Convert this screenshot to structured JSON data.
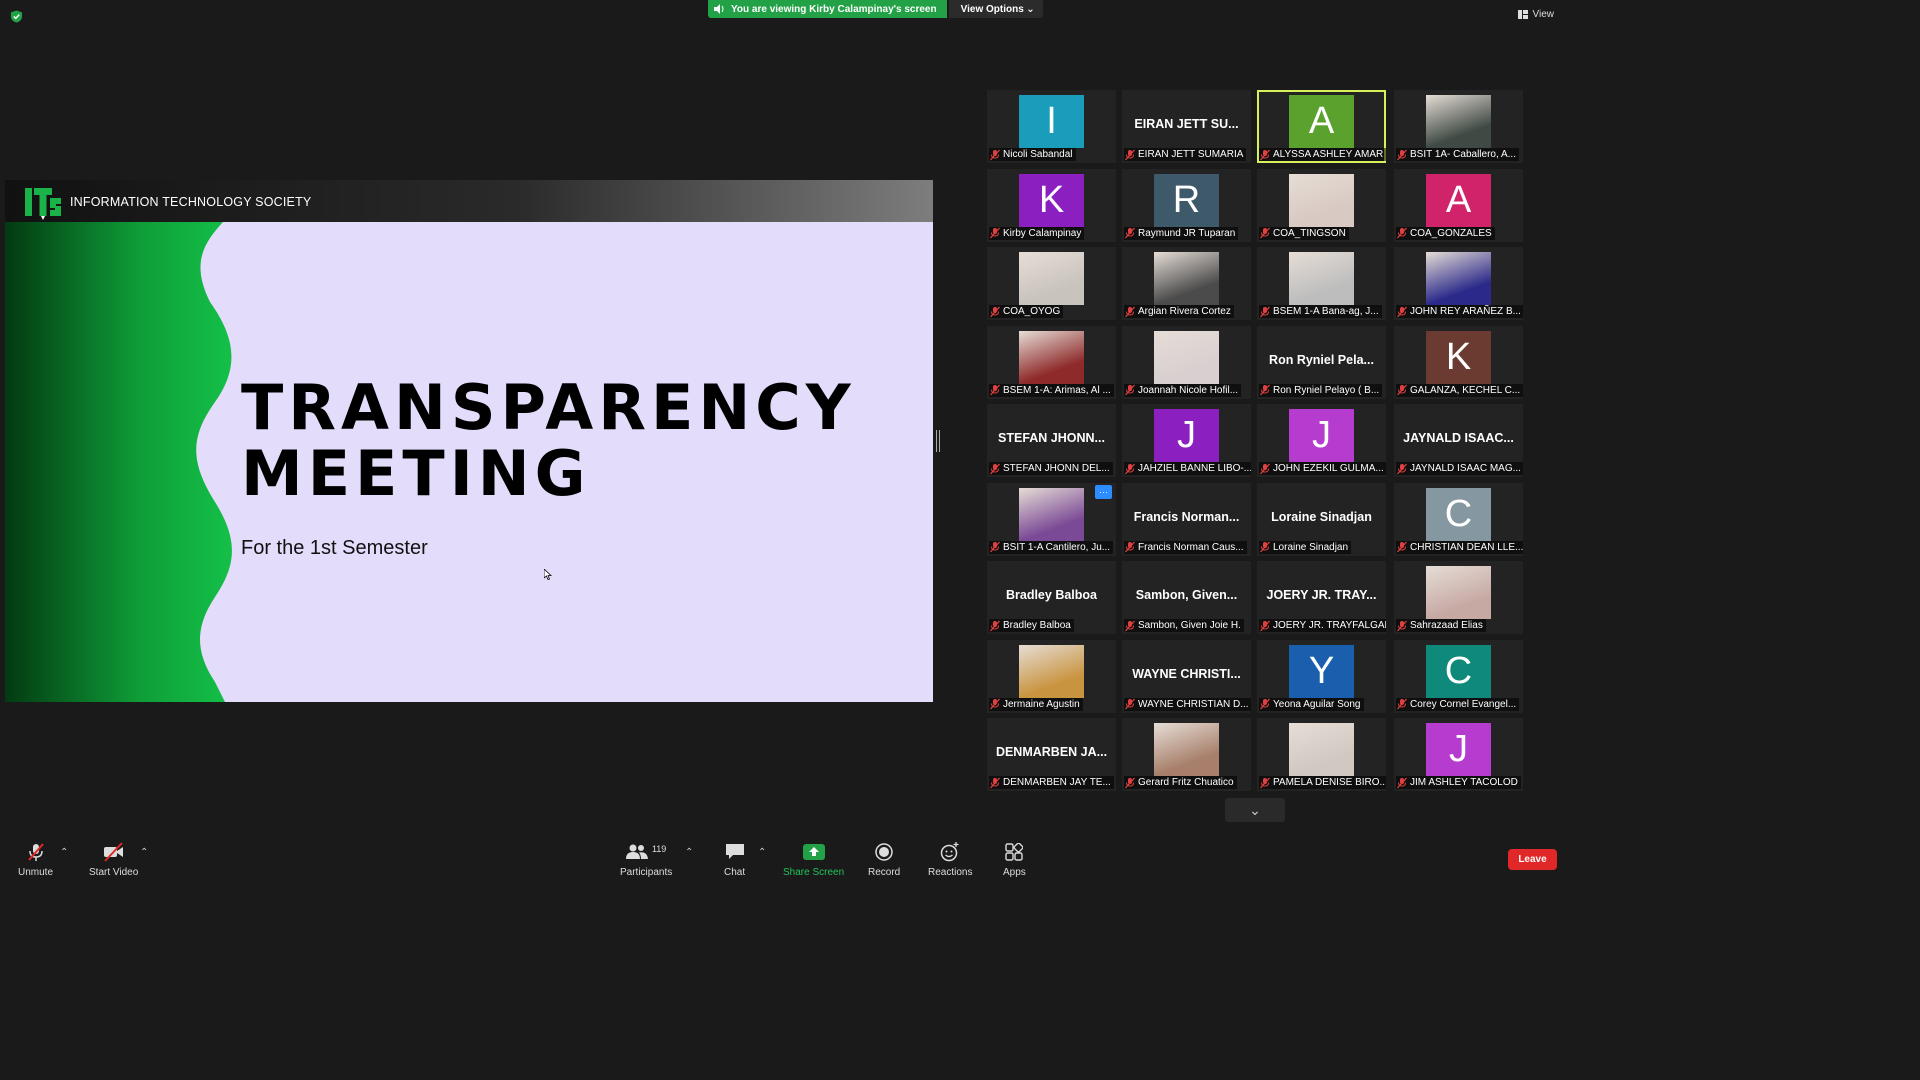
{
  "banner": {
    "viewing": "You are viewing Kirby Calampinay's screen",
    "view_options": "View Options"
  },
  "view_label": "View",
  "slide": {
    "org": "INFORMATION TECHNOLOGY SOCIETY",
    "title_line1": "TRANSPARENCY",
    "title_line2": "MEETING",
    "subtitle": "For the 1st Semester"
  },
  "participants": [
    {
      "name": "Nicoli Sabandal",
      "type": "letter",
      "letter": "I",
      "color": "#1a9dbb"
    },
    {
      "name": "EIRAN JETT SUMARIA",
      "type": "text",
      "display": "EIRAN JETT SU..."
    },
    {
      "name": "ALYSSA ASHLEY AMAR",
      "type": "letter",
      "letter": "A",
      "color": "#5aa12e",
      "active": true
    },
    {
      "name": "BSIT 1A- Caballero, A...",
      "type": "photo",
      "tone": "#3f4a44"
    },
    {
      "name": "Kirby Calampinay",
      "type": "letter",
      "letter": "K",
      "color": "#8b1fbf"
    },
    {
      "name": "Raymund JR Tuparan",
      "type": "letter",
      "letter": "R",
      "color": "#3e5969"
    },
    {
      "name": "COA_TINGSON",
      "type": "photo",
      "tone": "#d8c9c2"
    },
    {
      "name": "COA_GONZALES",
      "type": "letter",
      "letter": "A",
      "color": "#d1236a"
    },
    {
      "name": "COA_OYOG",
      "type": "photo",
      "tone": "#c9c3bd"
    },
    {
      "name": "Argian Rivera Cortez",
      "type": "photo",
      "tone": "#4b4b4b"
    },
    {
      "name": "BSEM 1-A Bana-ag, J...",
      "type": "photo",
      "tone": "#bdbdbd"
    },
    {
      "name": "JOHN REY ARAÑEZ B...",
      "type": "photo",
      "tone": "#2b2a8a"
    },
    {
      "name": "BSEM 1-A: Arimas, Al ...",
      "type": "photo",
      "tone": "#8e2a2a"
    },
    {
      "name": "Joannah Nicole Hofil...",
      "type": "photo",
      "tone": "#d8d0d0"
    },
    {
      "name": "Ron Ryniel Pelayo ( B...",
      "type": "text",
      "display": "Ron Ryniel Pela..."
    },
    {
      "name": "GALANZA, KECHEL C...",
      "type": "letter",
      "letter": "K",
      "color": "#6b3b32"
    },
    {
      "name": "STEFAN JHONN DEL...",
      "type": "text",
      "display": "STEFAN JHONN..."
    },
    {
      "name": "JAHZIEL BANNE LIBO-...",
      "type": "letter",
      "letter": "J",
      "color": "#8b1fbf"
    },
    {
      "name": "JOHN EZEKIL GULMA...",
      "type": "letter",
      "letter": "J",
      "color": "#b63ccf"
    },
    {
      "name": "JAYNALD ISAAC MAG...",
      "type": "text",
      "display": "JAYNALD ISAAC..."
    },
    {
      "name": "BSIT 1-A Cantilero, Ju...",
      "type": "photo",
      "tone": "#7b4a96",
      "more": true
    },
    {
      "name": "Francis Norman Caus...",
      "type": "text",
      "display": "Francis Norman..."
    },
    {
      "name": "Loraine Sinadjan",
      "type": "text",
      "display": "Loraine Sinadjan"
    },
    {
      "name": "CHRISTIAN DEAN LLE...",
      "type": "letter",
      "letter": "C",
      "color": "#8597a0"
    },
    {
      "name": "Bradley Balboa",
      "type": "text",
      "display": "Bradley Balboa"
    },
    {
      "name": "Sambon, Given Joie H.",
      "type": "text",
      "display": "Sambon, Given..."
    },
    {
      "name": "JOERY JR. TRAYFALGAR",
      "type": "text",
      "display": "JOERY JR. TRAY..."
    },
    {
      "name": "Sahrazaad Elias",
      "type": "photo",
      "tone": "#c7a9a4"
    },
    {
      "name": "Jermaine Agustin",
      "type": "photo",
      "tone": "#c9943f"
    },
    {
      "name": "WAYNE CHRISTIAN D...",
      "type": "text",
      "display": "WAYNE CHRISTI..."
    },
    {
      "name": "Yeona Aguilar Song",
      "type": "letter",
      "letter": "Y",
      "color": "#1a5fae"
    },
    {
      "name": "Corey Cornel Evangel...",
      "type": "letter",
      "letter": "C",
      "color": "#0f8a7a"
    },
    {
      "name": "DENMARBEN JAY TE...",
      "type": "text",
      "display": "DENMARBEN JA..."
    },
    {
      "name": "Gerard Fritz Chuatico",
      "type": "photo",
      "tone": "#a77f6a"
    },
    {
      "name": "PAMELA DENISE BIRO...",
      "type": "photo",
      "tone": "#d2c8c2"
    },
    {
      "name": "JIM ASHLEY TACOLOD",
      "type": "letter",
      "letter": "J",
      "color": "#b63ccf"
    }
  ],
  "toolbar": {
    "unmute": "Unmute",
    "start_video": "Start Video",
    "participants": "Participants",
    "participant_count": "119",
    "chat": "Chat",
    "share_screen": "Share Screen",
    "record": "Record",
    "reactions": "Reactions",
    "apps": "Apps",
    "leave": "Leave"
  },
  "colors": {
    "share_green": "#23a147",
    "leave_red": "#e02828",
    "active_speaker": "#d8f05a"
  }
}
